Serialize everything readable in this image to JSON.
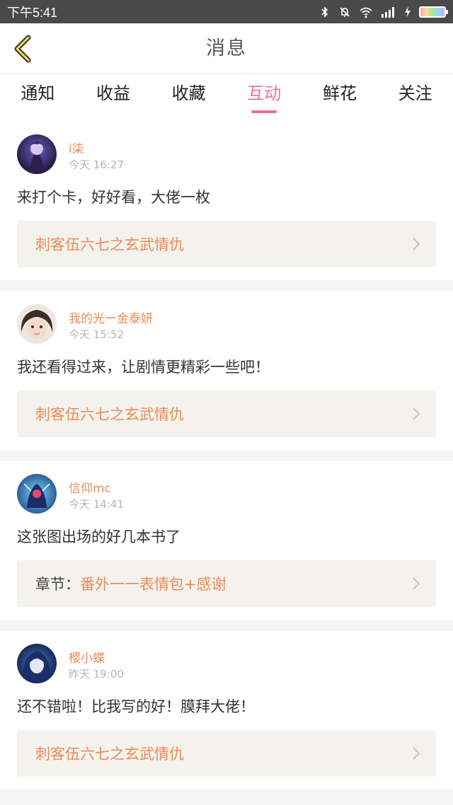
{
  "status_bar": {
    "time": "下午5:41",
    "icons": [
      "bluetooth-icon",
      "mute-icon",
      "wifi-icon",
      "signal-icon",
      "charging-icon",
      "battery-icon"
    ]
  },
  "header": {
    "title": "消息",
    "back_icon": "chevron-left-icon"
  },
  "tabs": [
    {
      "label": "通知",
      "active": false
    },
    {
      "label": "收益",
      "active": false
    },
    {
      "label": "收藏",
      "active": false
    },
    {
      "label": "互动",
      "active": true
    },
    {
      "label": "鲜花",
      "active": false
    },
    {
      "label": "关注",
      "active": false
    }
  ],
  "colors": {
    "accent": "#f06ca0",
    "name": "#e98c5a",
    "time": "#b5b5b5",
    "ref_bg": "#f4f2ec"
  },
  "items": [
    {
      "user": "i柒",
      "time": "今天 16:27",
      "message": "来打个卡，好好看，大佬一枚",
      "ref_label": "",
      "ref_title": "刺客伍六七之玄武情仇"
    },
    {
      "user": "我的光ー金泰妍",
      "time": "今天 15:52",
      "message": "我还看得过来，让剧情更精彩一些吧！",
      "ref_label": "",
      "ref_title": "刺客伍六七之玄武情仇"
    },
    {
      "user": "信仰mc",
      "time": "今天 14:41",
      "message": "这张图出场的好几本书了",
      "ref_label": "章节：",
      "ref_title": "番外一一表情包+感谢"
    },
    {
      "user": "樱小蝶",
      "time": "昨天 19:00",
      "message": "还不错啦！比我写的好！膜拜大佬！",
      "ref_label": "",
      "ref_title": "刺客伍六七之玄武情仇"
    }
  ]
}
